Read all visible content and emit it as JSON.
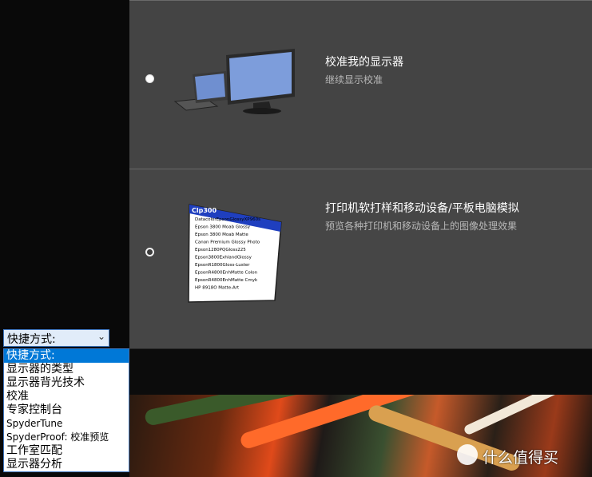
{
  "options": [
    {
      "title": "校准我的显示器",
      "subtitle": "继续显示校准",
      "selected": true
    },
    {
      "title": "打印机软打样和移动设备/平板电脑模拟",
      "subtitle": "预览各种打印机和移动设备上的图像处理效果",
      "selected": false
    }
  ],
  "printer_list": {
    "header": "Clp300",
    "items": [
      "DatacolorEpsonGlossyXP960s",
      "Epson 3800 Moab Glossy",
      "Epson 3800 Moab Matte",
      "Canon Premium Glossy Photo",
      "Epson1280PQGloss225",
      "Epson3800ExhlandGlossy",
      "EpsonR1800Gloss-Luster",
      "EpsonR4800EnhMatte Colon",
      "EpsonR4800EnhMatte Cmyk",
      "HP 8918O Matte-Art"
    ]
  },
  "shortcut_combo": {
    "label": "快捷方式:",
    "arrow": "⌄"
  },
  "shortcut_menu": [
    "快捷方式:",
    "显示器的类型",
    "显示器背光技术",
    "校准",
    "专家控制台",
    "SpyderTune",
    "SpyderProof: 校准预览",
    "工作室匹配",
    "显示器分析"
  ],
  "watermark": {
    "text": "什么值得买",
    "logo_glyph": "值"
  },
  "colors": {
    "panel": "#444444",
    "accent": "#0078d7",
    "combo_bg": "#e1ecf9"
  }
}
